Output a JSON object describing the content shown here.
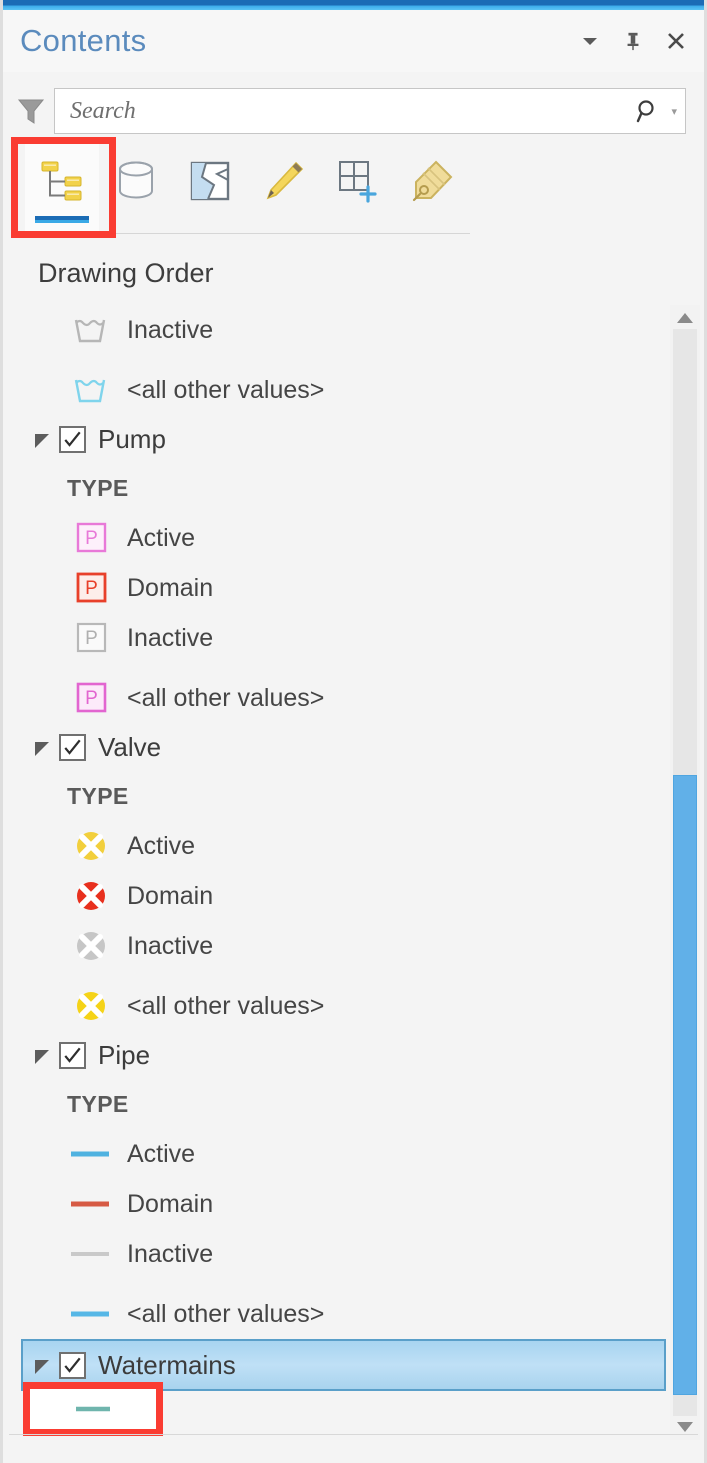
{
  "pane": {
    "title": "Contents",
    "window_controls": [
      {
        "name": "menu-dropdown",
        "glyph": "▾"
      },
      {
        "name": "auto-hide-pin",
        "glyph": "pin"
      },
      {
        "name": "close",
        "glyph": "✕"
      }
    ],
    "accent_color": "#1b6cb5",
    "title_color": "#5b8bbd"
  },
  "search": {
    "placeholder": "Search",
    "value": "",
    "filter_icon": "funnel-icon",
    "magnifier_icon": "search-icon",
    "caret": "▾"
  },
  "tabs": [
    {
      "label": "List By Drawing Order",
      "icon": "drawing-order-icon",
      "active": true
    },
    {
      "label": "List By Data Source",
      "icon": "data-source-icon",
      "active": false
    },
    {
      "label": "List By Selection",
      "icon": "selection-icon",
      "active": false
    },
    {
      "label": "List By Editing",
      "icon": "editing-pencil-icon",
      "active": false
    },
    {
      "label": "List By Snapping",
      "icon": "snapping-grid-icon",
      "active": false
    },
    {
      "label": "List By Labeling",
      "icon": "labeling-tag-icon",
      "active": false
    }
  ],
  "section_header": "Drawing Order",
  "tree": [
    {
      "kind": "symbol",
      "symbol": "tank",
      "color": "#b6b6b6",
      "label": "Inactive"
    },
    {
      "kind": "symbol",
      "symbol": "tank",
      "color": "#7fd4ec",
      "label": "<all other values>",
      "gap": true
    },
    {
      "kind": "layer",
      "label": "Pump",
      "checked": true,
      "expanded": true,
      "field": "TYPE",
      "symbols": [
        {
          "symbol": "point-p",
          "color": "#e879d8",
          "label": "Active"
        },
        {
          "symbol": "point-p",
          "color": "#e8402a",
          "label": "Domain"
        },
        {
          "symbol": "point-p",
          "color": "#b8b8b8",
          "label": "Inactive"
        },
        {
          "symbol": "point-p",
          "color": "#e265d0",
          "label": "<all other values>",
          "gap": true
        }
      ]
    },
    {
      "kind": "layer",
      "label": "Valve",
      "checked": true,
      "expanded": true,
      "field": "TYPE",
      "symbols": [
        {
          "symbol": "valve",
          "color": "#f2cf3c",
          "label": "Active"
        },
        {
          "symbol": "valve",
          "color": "#e8301e",
          "label": "Domain"
        },
        {
          "symbol": "valve",
          "color": "#bfbfbf",
          "label": "Inactive"
        },
        {
          "symbol": "valve",
          "color": "#f5d318",
          "label": "<all other values>",
          "gap": true
        }
      ]
    },
    {
      "kind": "layer",
      "label": "Pipe",
      "checked": true,
      "expanded": true,
      "field": "TYPE",
      "symbols": [
        {
          "symbol": "line",
          "color": "#4fb2e0",
          "label": "Active"
        },
        {
          "symbol": "line",
          "color": "#d65a44",
          "label": "Domain"
        },
        {
          "symbol": "line",
          "color": "#c9c9c9",
          "label": "Inactive"
        },
        {
          "symbol": "line",
          "color": "#56b7e6",
          "label": "<all other values>",
          "gap": true
        }
      ]
    },
    {
      "kind": "layer",
      "label": "Watermains",
      "checked": true,
      "expanded": true,
      "selected": true,
      "symbols": [
        {
          "symbol": "line",
          "color": "#6fb5ad",
          "label": "",
          "annotated": true
        }
      ]
    }
  ],
  "scrollbar": {
    "up_arrow": "▲",
    "down_arrow": "▼",
    "thumb_color": "#61b0e8"
  },
  "annotations": [
    {
      "name": "highlight-drawing-order-tab",
      "color": "#fa3c32"
    },
    {
      "name": "highlight-watermains-symbol",
      "color": "#fa3c32"
    }
  ]
}
